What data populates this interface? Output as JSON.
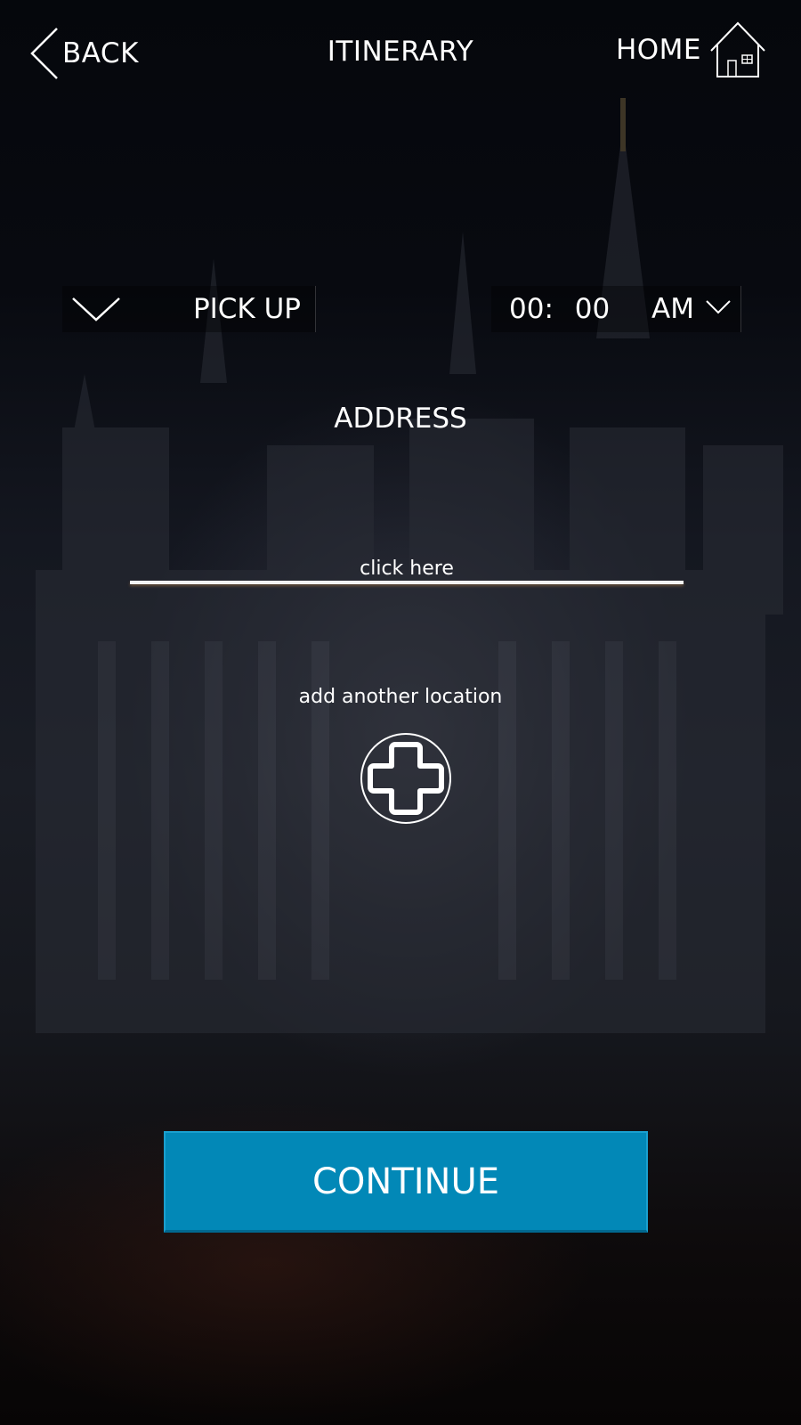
{
  "header": {
    "back_label": "BACK",
    "title": "ITINERARY",
    "home_label": "HOME"
  },
  "pickup": {
    "type_label": "PICK UP",
    "time_value": "00: 00",
    "ampm": "AM"
  },
  "address": {
    "title": "ADDRESS",
    "placeholder": "click here",
    "add_location_label": "add another location"
  },
  "actions": {
    "continue_label": "CONTINUE"
  },
  "colors": {
    "accent": "#0288b7",
    "text": "#ffffff"
  },
  "icons": {
    "back": "chevron-left-icon",
    "home": "house-icon",
    "dropdown": "chevron-down-icon",
    "add": "plus-circle-icon"
  }
}
